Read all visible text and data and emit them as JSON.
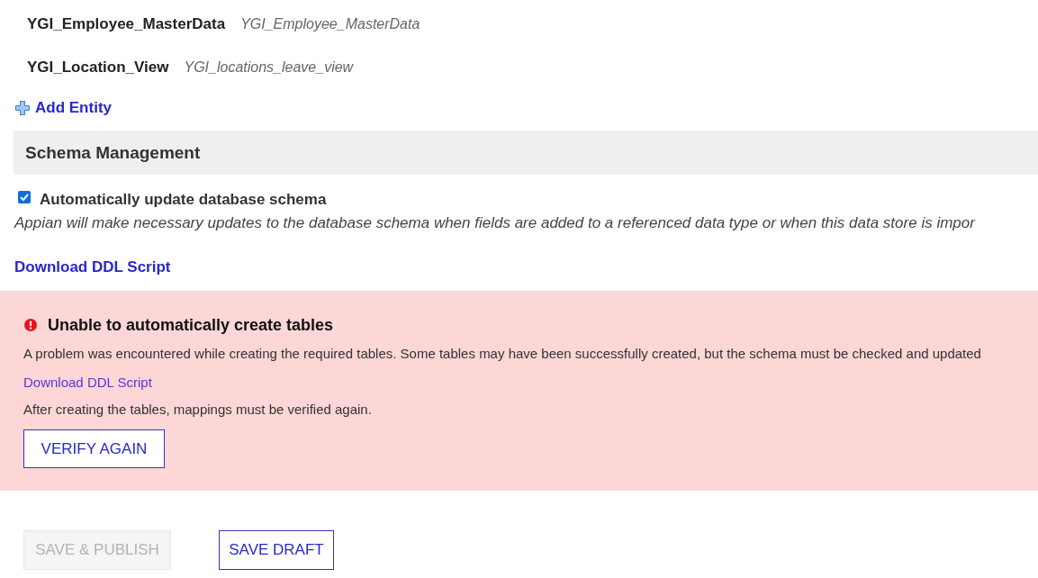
{
  "entities": [
    {
      "name": "YGI_Employee_MasterData",
      "value": "YGI_Employee_MasterData"
    },
    {
      "name": "YGI_Location_View",
      "value": "YGI_locations_leave_view"
    }
  ],
  "add_entity_link": "Add Entity",
  "schema_management": {
    "title": "Schema Management",
    "auto_update": {
      "label": "Automatically update database schema",
      "checked": true
    },
    "description": "Appian will make necessary updates to the database schema when fields are added to a referenced data type or when this data store is impor",
    "download_link": "Download DDL Script"
  },
  "error_panel": {
    "title": "Unable to automatically create tables",
    "message": "A problem was encountered while creating the required tables. Some tables may have been successfully created, but the schema must be checked and updated",
    "download_link": "Download DDL Script",
    "note": "After creating the tables, mappings must be verified again.",
    "button": "VERIFY AGAIN"
  },
  "footer_buttons": [
    {
      "label": "SAVE & PUBLISH",
      "disabled": true
    },
    {
      "label": "SAVE DRAFT",
      "disabled": false
    }
  ]
}
